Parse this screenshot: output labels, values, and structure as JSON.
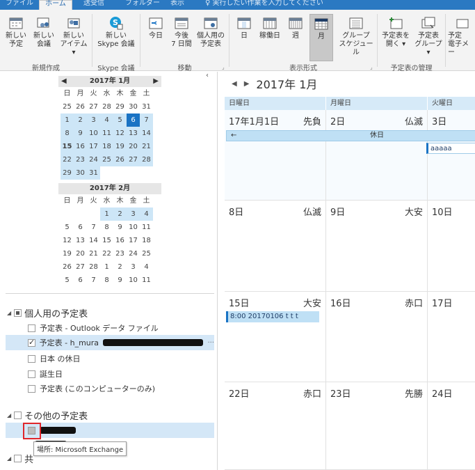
{
  "tabs": [
    "ファイル",
    "ホーム",
    "送受信",
    "フォルダー",
    "表示",
    "♀ 実行したい作業を入力してください"
  ],
  "ribbon": {
    "new_appt": "新しい\n予定",
    "new_meeting": "新しい\n会議",
    "new_items": "新しい\nアイテム ▾",
    "skype_meeting": "新しい\nSkype 会議",
    "today": "今日",
    "next7": "今後\n7 日間",
    "personal": "個人用の\n予定表",
    "day": "日",
    "workweek": "稼働日",
    "week": "週",
    "month": "月",
    "group_schedule": "グループ\nスケジュール",
    "open_cal": "予定表を\n開く ▾",
    "cal_groups": "予定表\nグループ ▾",
    "email_cal": "予定\n電子メー",
    "groups": {
      "new": "新規作成",
      "skype": "Skype 会議",
      "move": "移動",
      "format": "表示形式",
      "manage": "予定表の管理"
    }
  },
  "minical": [
    {
      "title": "2017年 1月",
      "dow": [
        "日",
        "月",
        "火",
        "水",
        "木",
        "金",
        "土"
      ],
      "weeks": [
        [
          "25",
          "26",
          "27",
          "28",
          "29",
          "30",
          "31"
        ],
        [
          "1",
          "2",
          "3",
          "4",
          "5",
          "6",
          "7"
        ],
        [
          "8",
          "9",
          "10",
          "11",
          "12",
          "13",
          "14"
        ],
        [
          "15",
          "16",
          "17",
          "18",
          "19",
          "20",
          "21"
        ],
        [
          "22",
          "23",
          "24",
          "25",
          "26",
          "27",
          "28"
        ],
        [
          "29",
          "30",
          "31",
          "",
          "",
          "",
          ""
        ]
      ]
    },
    {
      "title": "2017年 2月",
      "dow": [
        "日",
        "月",
        "火",
        "水",
        "木",
        "金",
        "土"
      ],
      "weeks": [
        [
          "",
          "",
          "",
          "1",
          "2",
          "3",
          "4"
        ],
        [
          "5",
          "6",
          "7",
          "8",
          "9",
          "10",
          "11"
        ],
        [
          "12",
          "13",
          "14",
          "15",
          "16",
          "17",
          "18"
        ],
        [
          "19",
          "20",
          "21",
          "22",
          "23",
          "24",
          "25"
        ],
        [
          "26",
          "27",
          "28",
          "1",
          "2",
          "3",
          "4"
        ],
        [
          "5",
          "6",
          "7",
          "8",
          "9",
          "10",
          "11"
        ]
      ]
    }
  ],
  "folders": {
    "personal_head": "個人用の予定表",
    "items": [
      "予定表 - Outlook データ ファイル",
      "予定表 - h_mura",
      "日本 の休日",
      "誕生日",
      "予定表 (このコンピューターのみ)"
    ],
    "other_head": "その他の予定表",
    "shared_head": "共",
    "tooltip": "場所: Microsoft Exchange"
  },
  "month": {
    "title": "2017年 1月",
    "headers": [
      "日曜日",
      "月曜日",
      "火曜日"
    ],
    "rows": [
      [
        {
          "d": "17年1月1日",
          "r": "先負"
        },
        {
          "d": "2日",
          "r": "仏滅"
        },
        {
          "d": "3日",
          "r": ""
        }
      ],
      [
        {
          "d": "8日",
          "r": "仏滅"
        },
        {
          "d": "9日",
          "r": "大安"
        },
        {
          "d": "10日",
          "r": ""
        }
      ],
      [
        {
          "d": "15日",
          "r": "大安"
        },
        {
          "d": "16日",
          "r": "赤口"
        },
        {
          "d": "17日",
          "r": ""
        }
      ],
      [
        {
          "d": "22日",
          "r": "赤口"
        },
        {
          "d": "23日",
          "r": "先勝"
        },
        {
          "d": "24日",
          "r": ""
        }
      ]
    ],
    "holiday_arrow": "←",
    "holiday": "休日",
    "appt_aaaaa": "aaaaa",
    "appt_15": "8:00 20170106 t t t"
  }
}
